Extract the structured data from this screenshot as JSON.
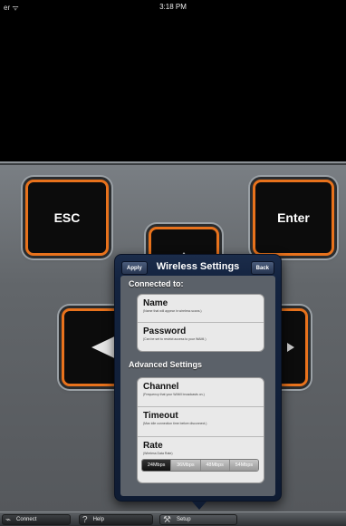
{
  "status_bar": {
    "carrier": "er ᯤ",
    "time": "3:18 PM"
  },
  "remote": {
    "esc_label": "ESC",
    "enter_label": "Enter"
  },
  "popover": {
    "title": "Wireless Settings",
    "apply_label": "Apply",
    "back_label": "Back",
    "connected_section": "Connected to:",
    "advanced_section": "Advanced Settings",
    "connected_rows": [
      {
        "title": "Name",
        "subtitle": "(Name that will appear in wireless scans.)"
      },
      {
        "title": "Password",
        "subtitle": "(Can be set to restrict access to your WAMI.)"
      }
    ],
    "advanced_rows": [
      {
        "title": "Channel",
        "subtitle": "(Frequency that your WAMI broadcasts on.)"
      },
      {
        "title": "Timeout",
        "subtitle": "(Max idle connection time before disconnect.)"
      },
      {
        "title": "Rate",
        "subtitle": "(Wireless Data Rate)"
      }
    ],
    "rate_options": [
      "24Mbps",
      "36Mbps",
      "48Mbps",
      "54Mbps"
    ],
    "rate_selected": "24Mbps"
  },
  "tabbar": {
    "connect_label": "Connect",
    "help_label": "Help",
    "help_icon": "?",
    "setup_label": "Setup"
  },
  "colors": {
    "accent_orange": "#e8721c",
    "popover_navy": "#13233f",
    "panel_gray": "#62666a"
  }
}
